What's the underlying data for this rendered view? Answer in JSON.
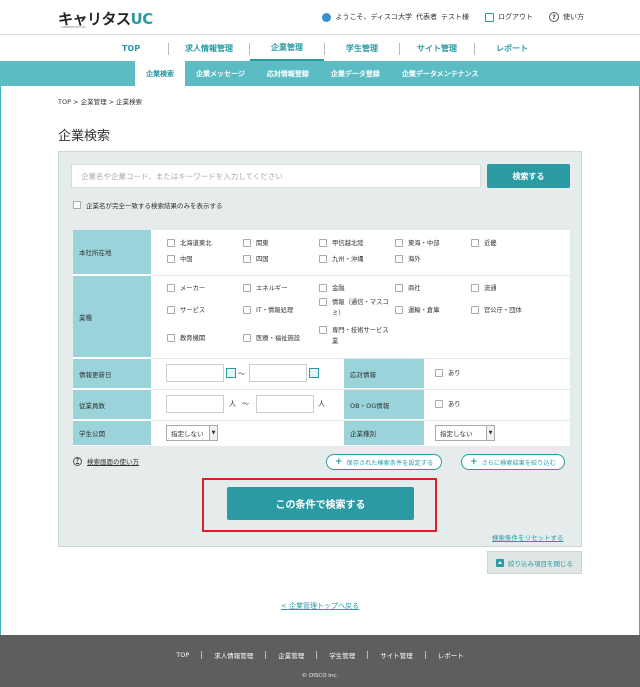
{
  "header": {
    "logo_main": "キャリタス",
    "logo_uc": "UC",
    "logo_sub": "CAREERTASU UC",
    "welcome": "ようこそ、ディスコ大学",
    "user": "代表者",
    "user_name": "テスト様",
    "logout": "ログアウト",
    "help": "使い方"
  },
  "main_nav": {
    "items": [
      {
        "label": "TOP"
      },
      {
        "label": "求人情報管理"
      },
      {
        "label": "企業管理"
      },
      {
        "label": "学生管理"
      },
      {
        "label": "サイト管理"
      },
      {
        "label": "レポート"
      }
    ],
    "active": "企業管理"
  },
  "sub_nav": {
    "items": [
      {
        "label": "企業検索"
      },
      {
        "label": "企業メッセージ"
      },
      {
        "label": "応対情報登録"
      },
      {
        "label": "企業データ登録"
      },
      {
        "label": "企業データメンテナンス"
      }
    ],
    "active": "企業検索"
  },
  "breadcrumb": "TOP > 企業管理 > 企業検索",
  "page_title": "企業検索",
  "search": {
    "placeholder": "企業名や企業コード、またはキーワードを入力してください",
    "button": "検索する",
    "exact_match": "企業名が完全一致する検索結果のみを表示する"
  },
  "filters": {
    "location": {
      "label": "本社所在地",
      "options": [
        "北海道東北",
        "関東",
        "甲信越北陸",
        "東海・中部",
        "近畿",
        "中国",
        "四国",
        "九州・沖縄",
        "海外"
      ]
    },
    "industry": {
      "label": "業種",
      "options": [
        "メーカー",
        "エネルギー",
        "金融",
        "商社",
        "流通",
        "サービス",
        "IT・情報処理",
        "情報（通信・マスコミ）",
        "運輸・倉庫",
        "官公庁・団体",
        "教育機関",
        "医療・福祉施設",
        "専門・技術サービス業"
      ]
    },
    "updated": {
      "label": "情報更新日",
      "tilde": "～"
    },
    "response": {
      "label": "応対情報",
      "option": "あり"
    },
    "employees": {
      "label": "従業員数",
      "unit": "人",
      "tilde": "～"
    },
    "obog": {
      "label": "OB・OG情報",
      "option": "あり"
    },
    "student_public": {
      "label": "学生公開",
      "value": "指定しない"
    },
    "company_type": {
      "label": "企業種別",
      "value": "指定しない"
    }
  },
  "help_link": "検索画面の使い方",
  "save_conditions": "保存された検索条件を設定する",
  "refine": "さらに検索結果を絞り込む",
  "main_search_button": "この条件で検索する",
  "reset_link": "検索条件をリセットする",
  "close_filters": "絞り込み項目を閉じる",
  "back_link": "< 企業管理トップへ戻る",
  "footer": {
    "links": [
      "TOP",
      "求人情報管理",
      "企業管理",
      "学生管理",
      "サイト管理",
      "レポート"
    ],
    "copyright": "© DISCO Inc."
  }
}
